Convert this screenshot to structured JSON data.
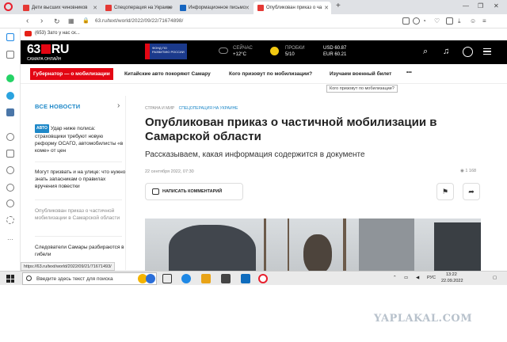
{
  "browser": {
    "tabs": [
      {
        "label": "Дети высших чиновников"
      },
      {
        "label": "Спецоперация на Украине"
      },
      {
        "label": "Информационное письмо"
      },
      {
        "label": "Опубликован приказ о ча"
      }
    ],
    "new_tab": "+",
    "url": "63.ru/text/world/2022/09/22/71674898/",
    "bookmark": "(653) Зато у нас ск...",
    "status_url": "https://63.ru/text/world/2022/09/21/71671493/"
  },
  "site": {
    "logo_main": "63",
    "logo_ru": "RU",
    "logo_sub": "САМАРА ОНЛАЙН",
    "banner_text": "ФОНД ПО РАЗВИТИЮ РОССИИ",
    "weather_label": "СЕЙЧАС",
    "weather_value": "+12°C",
    "traffic_label": "ПРОБКИ",
    "traffic_value": "5/10",
    "usd": "USD 60.87",
    "eur": "EUR 60.21",
    "nav": {
      "highlight": "Губернатор — о мобилизации",
      "items": [
        "Китайские авто покоряют Самару",
        "Кого призовут по мобилизации?",
        "Изучаем военный билет"
      ],
      "more": "•••",
      "tooltip": "Кого призовут по мобилизации?"
    },
    "news": {
      "heading": "ВСЕ НОВОСТИ",
      "tag_auto": "АВТО",
      "items": [
        "Удар ниже полиса: страховщики требуют новую реформу ОСАГО, автомобилисты «в коме» от цен",
        "Могут призвать и на улице: что нужно знать запасникам о правилах вручения повестки",
        "Опубликован приказ о частичной мобилизации в Самарской области",
        "Следователи Самары разбираются в гибели"
      ]
    },
    "article": {
      "crumb1": "СТРАНА И МИР",
      "crumb2": "СПЕЦОПЕРАЦИЯ НА УКРАИНЕ",
      "title": "Опубликован приказ о частичной мобилизации в Самарской области",
      "subtitle": "Рассказываем, какая информация содержится в документе",
      "date": "22 сентября 2022, 07:30",
      "views": "1 168",
      "comment_label": "НАПИСАТЬ КОММЕНТАРИЙ"
    }
  },
  "taskbar": {
    "search_placeholder": "Введите здесь текст для поиска",
    "lang": "РУС",
    "time": "13:22",
    "date": "22.09.2022"
  },
  "watermark": "YAPLAKAL.COM"
}
